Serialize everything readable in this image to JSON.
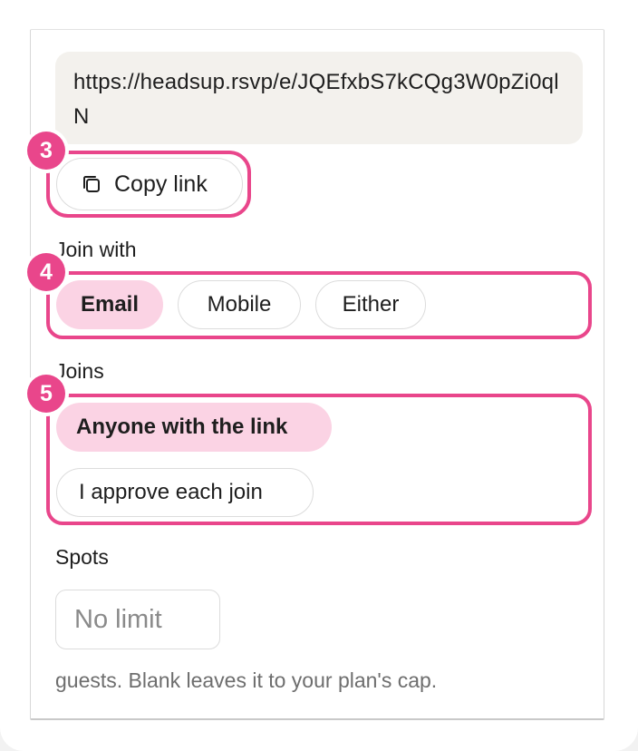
{
  "link": {
    "url": "https://headsup.rsvp/e/JQEfxbS7kCQg3W0pZi0qlN",
    "copy_label": "Copy link"
  },
  "callouts": {
    "copy_step": "3",
    "join_step": "4",
    "joins_step": "5"
  },
  "join_with": {
    "label": "Join with",
    "options": [
      "Email",
      "Mobile",
      "Either"
    ],
    "selected": "Email"
  },
  "joins": {
    "label": "Joins",
    "options": [
      "Anyone with the link",
      "I approve each join"
    ],
    "selected": "Anyone with the link"
  },
  "spots": {
    "label": "Spots",
    "placeholder": "No limit",
    "value": "",
    "helper": "guests. Blank leaves it to your plan's cap."
  },
  "colors": {
    "accent": "#e9468b",
    "selected_pill": "#fbd3e4",
    "url_background": "#f3f1ed"
  },
  "icons": {
    "copy": "copy-icon"
  }
}
